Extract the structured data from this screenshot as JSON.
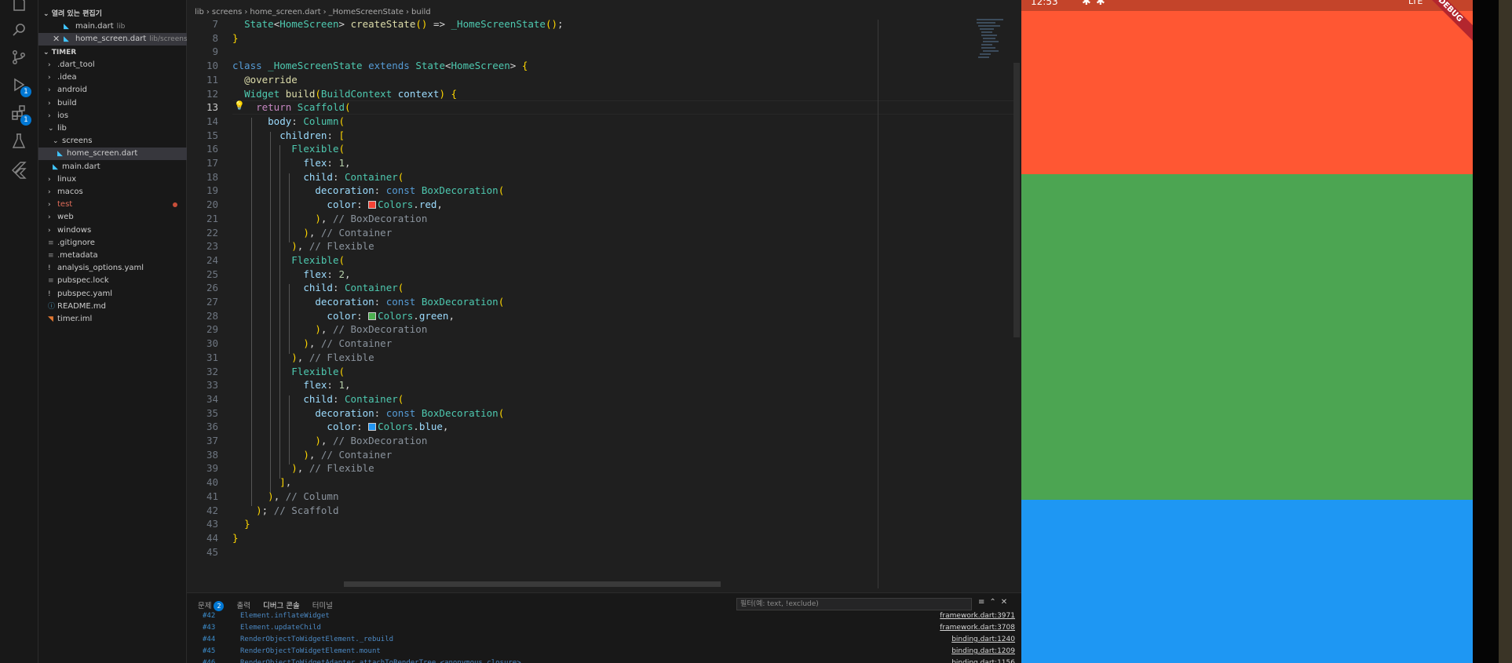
{
  "activity_bar": {
    "run_badge": "1",
    "extensions_badge": "1"
  },
  "explorer": {
    "open_editors_header": "열려 있는 편집기",
    "open_editors": [
      {
        "name": "main.dart",
        "desc": "lib"
      },
      {
        "name": "home_screen.dart",
        "desc": "lib/screens"
      }
    ],
    "project_header": "TIMER",
    "tree": [
      {
        "label": ".dart_tool",
        "kind": "folder"
      },
      {
        "label": ".idea",
        "kind": "folder"
      },
      {
        "label": "android",
        "kind": "folder"
      },
      {
        "label": "build",
        "kind": "folder"
      },
      {
        "label": "ios",
        "kind": "folder"
      },
      {
        "label": "lib",
        "kind": "folder-open"
      },
      {
        "label": "screens",
        "kind": "folder-open"
      },
      {
        "label": "home_screen.dart",
        "kind": "dart"
      },
      {
        "label": "main.dart",
        "kind": "dart"
      },
      {
        "label": "linux",
        "kind": "folder"
      },
      {
        "label": "macos",
        "kind": "folder"
      },
      {
        "label": "test",
        "kind": "folder"
      },
      {
        "label": "web",
        "kind": "folder"
      },
      {
        "label": "windows",
        "kind": "folder"
      },
      {
        "label": ".gitignore",
        "kind": "file"
      },
      {
        "label": ".metadata",
        "kind": "file"
      },
      {
        "label": "analysis_options.yaml",
        "kind": "yaml"
      },
      {
        "label": "pubspec.lock",
        "kind": "file"
      },
      {
        "label": "pubspec.yaml",
        "kind": "yaml"
      },
      {
        "label": "README.md",
        "kind": "info"
      },
      {
        "label": "timer.iml",
        "kind": "rss"
      }
    ]
  },
  "breadcrumb": [
    "lib",
    "screens",
    "home_screen.dart",
    "_HomeScreenState",
    "build"
  ],
  "editor": {
    "line_numbers": [
      "7",
      "8",
      "9",
      "10",
      "11",
      "12",
      "13",
      "14",
      "15",
      "16",
      "17",
      "18",
      "19",
      "20",
      "21",
      "22",
      "23",
      "24",
      "25",
      "26",
      "27",
      "28",
      "29",
      "30",
      "31",
      "32",
      "33",
      "34",
      "35",
      "36",
      "37",
      "38",
      "39",
      "40",
      "41",
      "42",
      "43",
      "44",
      "45"
    ],
    "current_line": "13",
    "lines": [
      "  State<HomeScreen> createState() => _HomeScreenState();",
      "}",
      "",
      "class _HomeScreenState extends State<HomeScreen> {",
      "  @override",
      "  Widget build(BuildContext context) {",
      "    return Scaffold(",
      "      body: Column(",
      "        children: [",
      "          Flexible(",
      "            flex: 1,",
      "            child: Container(",
      "              decoration: const BoxDecoration(",
      "                color: Colors.red,",
      "              ), // BoxDecoration",
      "            ), // Container",
      "          ), // Flexible",
      "          Flexible(",
      "            flex: 2,",
      "            child: Container(",
      "              decoration: const BoxDecoration(",
      "                color: Colors.green,",
      "              ), // BoxDecoration",
      "            ), // Container",
      "          ), // Flexible",
      "          Flexible(",
      "            flex: 1,",
      "            child: Container(",
      "              decoration: const BoxDecoration(",
      "                color: Colors.blue,",
      "              ), // BoxDecoration",
      "            ), // Container",
      "          ), // Flexible",
      "        ],",
      "      ), // Column",
      "    ); // Scaffold",
      "  }",
      "}",
      ""
    ]
  },
  "panel": {
    "tabs": [
      {
        "label": "문제",
        "badge": "2"
      },
      {
        "label": "출력"
      },
      {
        "label": "디버그 콘솔"
      },
      {
        "label": "터미널"
      }
    ],
    "filter_placeholder": "필터(예: text, !exclude)",
    "trace": [
      {
        "num": "#42",
        "fn": "Element.inflateWidget",
        "src": "framework.dart:3971"
      },
      {
        "num": "#43",
        "fn": "Element.updateChild",
        "src": "framework.dart:3708"
      },
      {
        "num": "#44",
        "fn": "RenderObjectToWidgetElement._rebuild",
        "src": "binding.dart:1240"
      },
      {
        "num": "#45",
        "fn": "RenderObjectToWidgetElement.mount",
        "src": "binding.dart:1209"
      },
      {
        "num": "#46",
        "fn": "RenderObjectToWidgetAdapter.attachToRenderTree.<anonymous closure>",
        "src": "binding.dart:1156"
      }
    ]
  },
  "emulator": {
    "time": "12:53",
    "network": "LTE",
    "debug_banner": "DEBUG",
    "flex_sections": [
      {
        "flex": 1,
        "color": "#ff5733"
      },
      {
        "flex": 2,
        "color": "#4ca552"
      },
      {
        "flex": 1,
        "color": "#1e97f3"
      }
    ]
  }
}
